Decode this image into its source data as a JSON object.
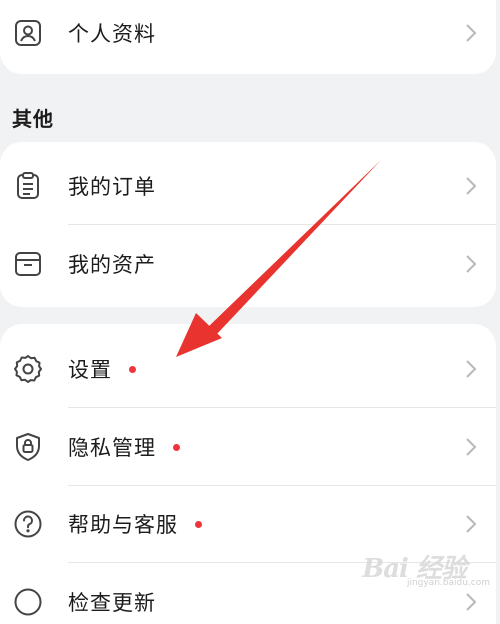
{
  "colors": {
    "background": "#f1f2f4",
    "card": "#ffffff",
    "badge_dot": "#f0343b",
    "annotation_arrow": "#e8332f",
    "text": "#1c1c1c",
    "chevron": "#b9b9b9"
  },
  "profile": {
    "label": "个人资料",
    "icon": "person-card-icon"
  },
  "other_section": {
    "title": "其他",
    "items": [
      {
        "label": "我的订单",
        "icon": "clipboard-icon"
      },
      {
        "label": "我的资产",
        "icon": "box-icon"
      }
    ]
  },
  "settings_section": {
    "items": [
      {
        "label": "设置",
        "icon": "gear-icon",
        "badge": true
      },
      {
        "label": "隐私管理",
        "icon": "shield-lock-icon",
        "badge": true
      },
      {
        "label": "帮助与客服",
        "icon": "question-circle-icon",
        "badge": true
      },
      {
        "label": "检查更新",
        "icon": "refresh-icon",
        "badge": false
      }
    ]
  },
  "watermark": {
    "logo": "Bai 经验",
    "url": "jingyan.baidu.com"
  }
}
